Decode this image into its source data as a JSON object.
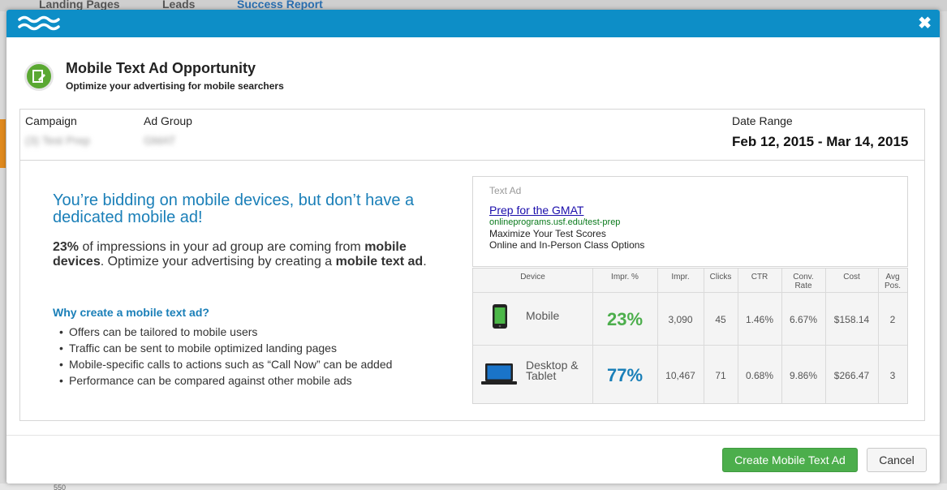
{
  "background": {
    "tabs": [
      "Landing Pages",
      "Leads",
      "Success Report"
    ],
    "axis_label": "550"
  },
  "modal": {
    "title": "Mobile Text Ad Opportunity",
    "subtitle": "Optimize your advertising for mobile searchers",
    "close_icon": "close-icon",
    "info": {
      "campaign_label": "Campaign",
      "campaign_value": "(3) Test Prep",
      "ad_group_label": "Ad Group",
      "ad_group_value": "GMAT",
      "date_range_label": "Date Range",
      "date_range_value": "Feb 12, 2015 - Mar 14, 2015"
    },
    "headline": "You’re bidding on mobile devices, but don’t have a dedicated mobile ad!",
    "body": {
      "pct": "23%",
      "part1": " of impressions in your ad group are coming from ",
      "bold1": "mobile devices",
      "part2": ". Optimize your advertising by creating a ",
      "bold2": "mobile text ad",
      "part3": "."
    },
    "why_title": "Why create a mobile text ad?",
    "bullets": [
      "Offers can be tailored to mobile users",
      "Traffic can be sent to mobile optimized landing pages",
      "Mobile-specific calls to actions such as “Call Now” can be added",
      "Performance can be compared against other mobile ads"
    ],
    "text_ad": {
      "label": "Text Ad",
      "title": "Prep for the GMAT",
      "url": "onlineprograms.usf.edu/test-prep",
      "line1": "Maximize Your Test Scores",
      "line2": "Online and In-Person Class Options"
    },
    "table": {
      "headers": {
        "device": "Device",
        "impr_pct": "Impr. %",
        "impr": "Impr.",
        "clicks": "Clicks",
        "ctr": "CTR",
        "conv_rate_1": "Conv.",
        "conv_rate_2": "Rate",
        "cost": "Cost",
        "avg_pos_1": "Avg",
        "avg_pos_2": "Pos."
      },
      "rows": [
        {
          "icon": "mobile-phone-icon",
          "device": "Mobile",
          "impr_pct": "23%",
          "impr": "3,090",
          "clicks": "45",
          "ctr": "1.46%",
          "conv_rate": "6.67%",
          "cost": "$158.14",
          "avg_pos": "2",
          "pct_color": "#4cae4c"
        },
        {
          "icon": "laptop-icon",
          "device_1": "Desktop &",
          "device_2": "Tablet",
          "impr_pct": "77%",
          "impr": "10,467",
          "clicks": "71",
          "ctr": "0.68%",
          "conv_rate": "9.86%",
          "cost": "$266.47",
          "avg_pos": "3",
          "pct_color": "#1a7fb8"
        }
      ]
    },
    "buttons": {
      "create": "Create Mobile Text Ad",
      "cancel": "Cancel"
    }
  }
}
